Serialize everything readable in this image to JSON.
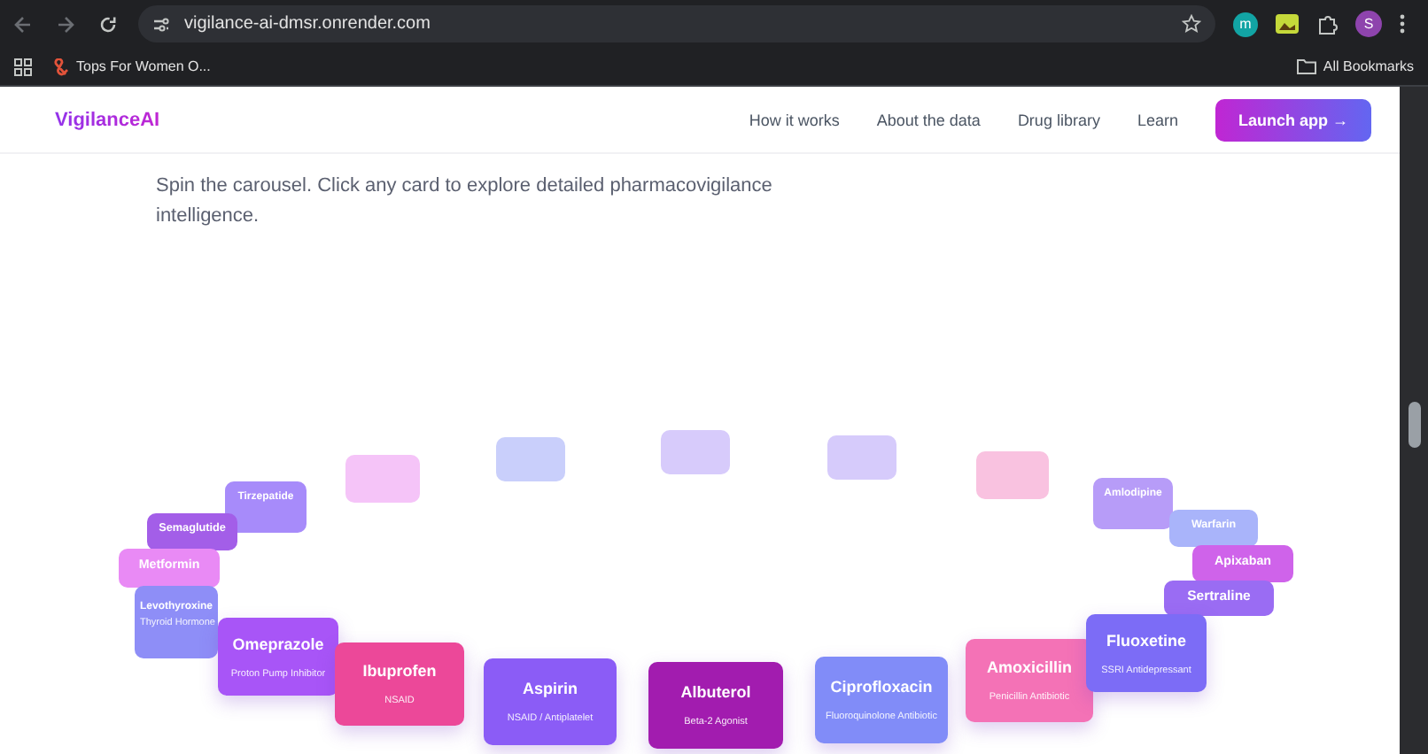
{
  "browser": {
    "url": "vigilance-ai-dmsr.onrender.com",
    "profile_initial": "S",
    "extension_initial": "m",
    "bookmarks": [
      {
        "label": "Tops For Women O..."
      }
    ],
    "all_bookmarks": "All Bookmarks"
  },
  "navbar": {
    "logo": "VigilanceAI",
    "links": [
      "How it works",
      "About the data",
      "Drug library",
      "Learn"
    ],
    "cta": "Launch app →"
  },
  "intro": "Spin the carousel. Click any card to explore detailed pharmacovigilance intelligence.",
  "carousel": [
    {
      "kind": "back"
    },
    {
      "kind": "back"
    },
    {
      "kind": "back"
    },
    {
      "kind": "back"
    },
    {
      "kind": "back"
    },
    {
      "name": "Tirzepatide",
      "kind": "middle"
    },
    {
      "name": "Amlodipine",
      "kind": "middle"
    },
    {
      "name": "Warfarin",
      "kind": "middle"
    },
    {
      "name": "Semaglutide",
      "kind": "middle"
    },
    {
      "name": "Apixaban",
      "kind": "middle"
    },
    {
      "name": "Metformin",
      "kind": "middle"
    },
    {
      "name": "Sertraline",
      "kind": "middle"
    },
    {
      "name": "Levothyroxine",
      "subtitle": "Thyroid Hormone",
      "kind": "middle"
    },
    {
      "name": "Omeprazole",
      "subtitle": "Proton Pump Inhibitor",
      "kind": "front",
      "color": "#a855f7"
    },
    {
      "name": "Ibuprofen",
      "subtitle": "NSAID",
      "kind": "front",
      "color": "#ec4899"
    },
    {
      "name": "Aspirin",
      "subtitle": "NSAID / Antiplatelet",
      "kind": "front",
      "color": "#8b5cf6"
    },
    {
      "name": "Albuterol",
      "subtitle": "Beta-2 Agonist",
      "kind": "front",
      "color": "#a21caf"
    },
    {
      "name": "Ciprofloxacin",
      "subtitle": "Fluoroquinolone Antibiotic",
      "kind": "front",
      "color": "#818cf8"
    },
    {
      "name": "Amoxicillin",
      "subtitle": "Penicillin Antibiotic",
      "kind": "front",
      "color": "#f472b6"
    },
    {
      "name": "Fluoxetine",
      "subtitle": "SSRI Antidepressant",
      "kind": "front",
      "color": "#7c6cf6"
    }
  ]
}
